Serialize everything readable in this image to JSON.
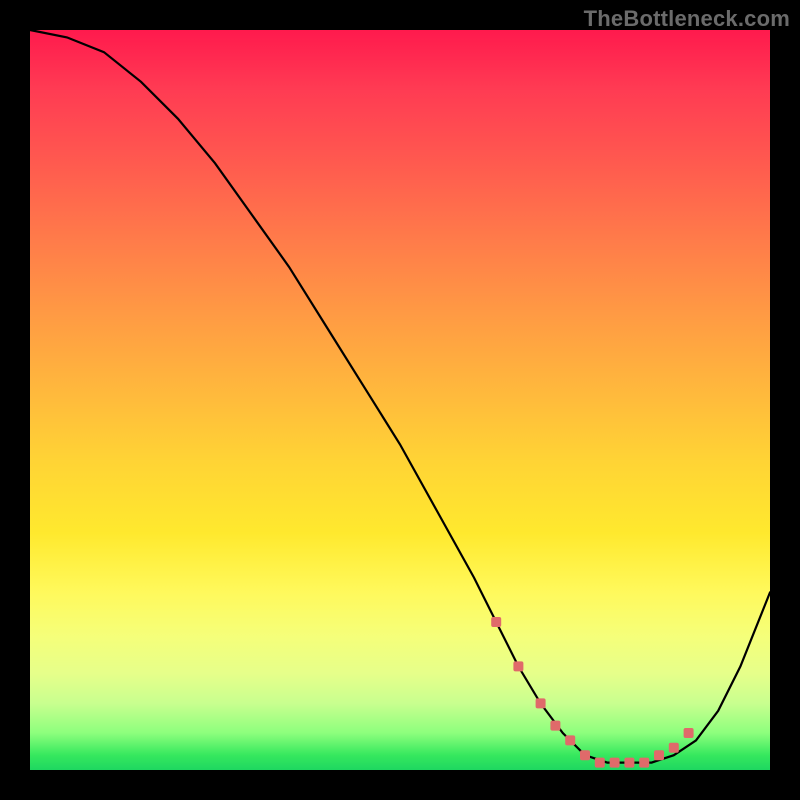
{
  "watermark": "TheBottleneck.com",
  "chart_data": {
    "type": "line",
    "title": "",
    "xlabel": "",
    "ylabel": "",
    "xlim": [
      0,
      100
    ],
    "ylim": [
      0,
      100
    ],
    "series": [
      {
        "name": "curve",
        "x": [
          0,
          5,
          10,
          15,
          20,
          25,
          30,
          35,
          40,
          45,
          50,
          55,
          60,
          63,
          66,
          69,
          72,
          75,
          78,
          81,
          84,
          87,
          90,
          93,
          96,
          100
        ],
        "values": [
          100,
          99,
          97,
          93,
          88,
          82,
          75,
          68,
          60,
          52,
          44,
          35,
          26,
          20,
          14,
          9,
          5,
          2,
          1,
          1,
          1,
          2,
          4,
          8,
          14,
          24
        ]
      }
    ],
    "markers": {
      "name": "highlight-points",
      "color": "#e06a6a",
      "x": [
        63,
        66,
        69,
        71,
        73,
        75,
        77,
        79,
        81,
        83,
        85,
        87,
        89
      ],
      "values": [
        20,
        14,
        9,
        6,
        4,
        2,
        1,
        1,
        1,
        1,
        2,
        3,
        5
      ]
    }
  }
}
